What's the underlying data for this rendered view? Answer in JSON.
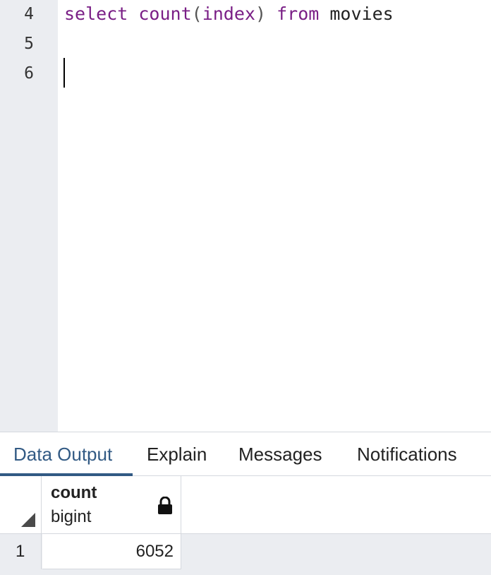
{
  "editor": {
    "lines": [
      {
        "number": "4",
        "tokens": [
          "select",
          "count",
          "(",
          "index",
          ")",
          "from",
          "movies"
        ]
      },
      {
        "number": "5"
      },
      {
        "number": "6"
      }
    ]
  },
  "tabs": [
    {
      "label": "Data Output",
      "active": true
    },
    {
      "label": "Explain",
      "active": false
    },
    {
      "label": "Messages",
      "active": false
    },
    {
      "label": "Notifications",
      "active": false
    }
  ],
  "grid": {
    "columns": [
      {
        "name": "count",
        "type": "bigint",
        "icon": "lock-icon"
      }
    ],
    "rows": [
      {
        "row_number": "1",
        "values": [
          "6052"
        ]
      }
    ]
  },
  "colors": {
    "keyword": "#7a1f86",
    "active_tab": "#325a84",
    "gutter_bg": "#ebedf1"
  }
}
